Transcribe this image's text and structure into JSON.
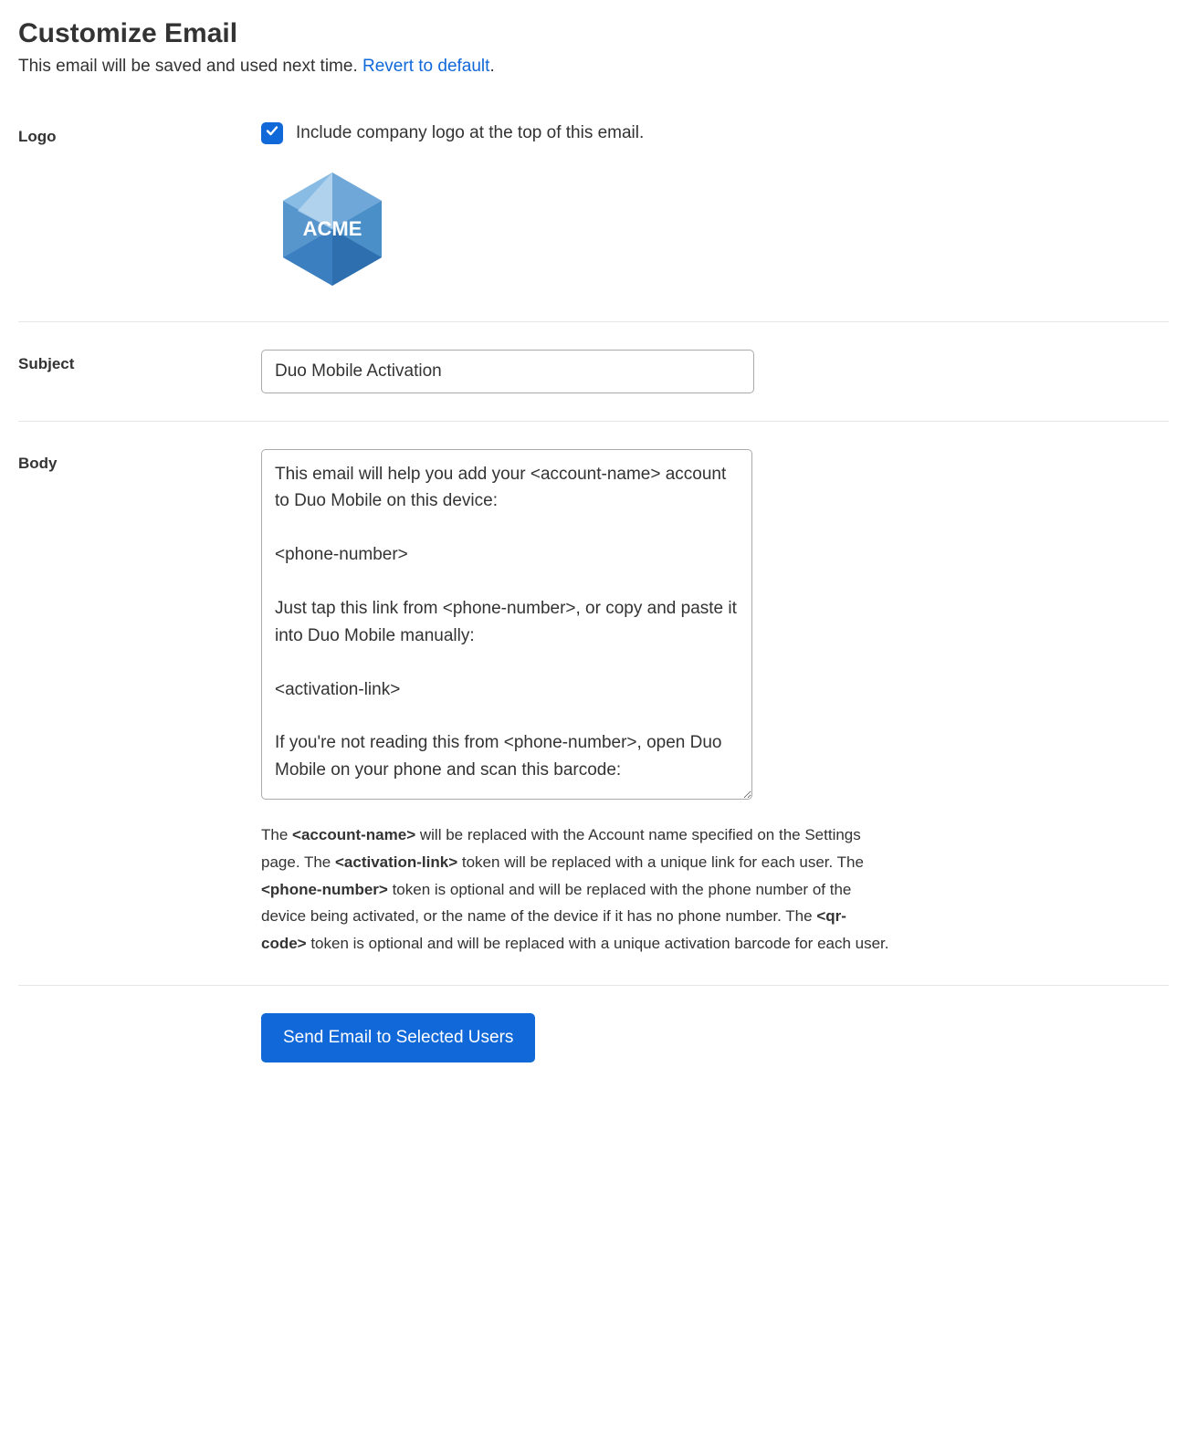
{
  "header": {
    "title": "Customize Email",
    "subtitle_prefix": "This email will be saved and used next time. ",
    "revert_link": "Revert to default",
    "subtitle_suffix": "."
  },
  "logo_section": {
    "label": "Logo",
    "checkbox_label": "Include company logo at the top of this email.",
    "checked": true,
    "logo_text": "ACME"
  },
  "subject_section": {
    "label": "Subject",
    "value": "Duo Mobile Activation"
  },
  "body_section": {
    "label": "Body",
    "value": "This email will help you add your <account-name> account to Duo Mobile on this device:\n\n<phone-number>\n\nJust tap this link from <phone-number>, or copy and paste it into Duo Mobile manually:\n\n<activation-link>\n\nIf you're not reading this from <phone-number>, open Duo Mobile on your phone and scan this barcode:",
    "help": {
      "t1": "The ",
      "b1": "<account-name>",
      "t2": " will be replaced with the Account name specified on the Settings page. The ",
      "b2": "<activation-link>",
      "t3": " token will be replaced with a unique link for each user. The ",
      "b3": "<phone-number>",
      "t4": " token is optional and will be replaced with the phone number of the device being activated, or the name of the device if it has no phone number. The ",
      "b4": "<qr-code>",
      "t5": " token is optional and will be replaced with a unique activation barcode for each user."
    }
  },
  "submit": {
    "label": "Send Email to Selected Users"
  }
}
